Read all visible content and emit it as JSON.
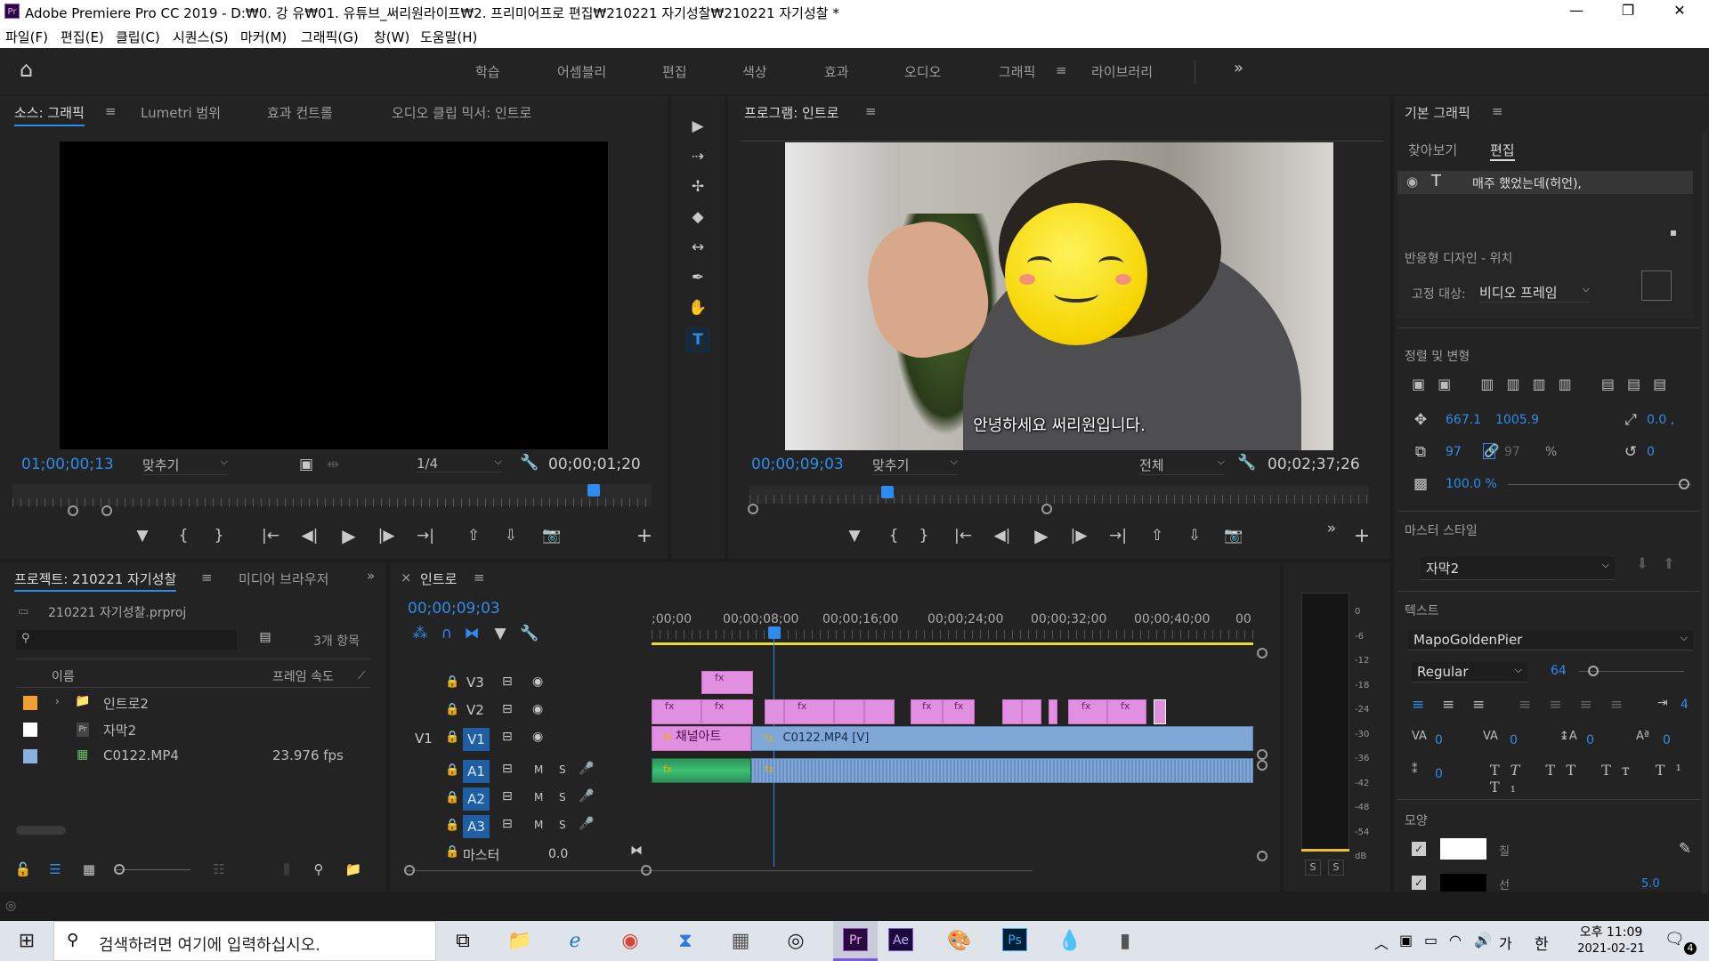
{
  "titlebar": {
    "title": "Adobe Premiere Pro CC 2019 - D:₩0. 강 유₩01. 유튜브_써리원라이프₩2. 프리미어프로 편집₩210221 자기성찰₩210221 자기성찰 *",
    "app_badge": "Pr",
    "min": "—",
    "max": "❐",
    "close": "✕"
  },
  "menu": [
    "파일(F)",
    "편집(E)",
    "클립(C)",
    "시퀀스(S)",
    "마커(M)",
    "그래픽(G)",
    "창(W)",
    "도움말(H)"
  ],
  "workspaces": {
    "items": [
      "학습",
      "어셈블리",
      "편집",
      "색상",
      "효과",
      "오디오",
      "그래픽",
      "라이브러리"
    ],
    "active": "그래픽",
    "menu_icon": "≡",
    "more": "»",
    "home": "⌂"
  },
  "source": {
    "tabs": [
      "소스: 그래픽",
      "Lumetri 범위",
      "효과 컨트롤",
      "오디오 클립 믹서: 인트로"
    ],
    "tab_menu": "≡",
    "timecode": "01;00;00;13",
    "fit": "맞추기",
    "resolution": "1/4",
    "duration": "00;00;01;20"
  },
  "program": {
    "title": "프로그램: 인트로",
    "menu": "≡",
    "caption": "안녕하세요 써리원입니다.",
    "timecode": "00;00;09;03",
    "fit": "맞추기",
    "quality": "전체",
    "duration": "00;02;37;26",
    "more": "»"
  },
  "tools": [
    "▶",
    "⇢",
    "✢",
    "◆",
    "↔",
    "✒",
    "✋",
    "T"
  ],
  "transport": {
    "marker": "▼",
    "in": "{",
    "out": "}",
    "go_in": "|←",
    "step_back": "◀|",
    "play": "▶",
    "step_fwd": "|▶",
    "go_out": "→|",
    "lift": "⇧",
    "extract": "⇩",
    "export": "📷",
    "add": "+"
  },
  "project": {
    "tab": "프로젝트: 210221 자기성찰",
    "menu": "≡",
    "tab2": "미디어 브라우저",
    "more": "»",
    "file": "210221 자기성찰.prproj",
    "count": "3개 항목",
    "col_name": "이름",
    "col_fps": "프레임 속도",
    "items": [
      {
        "name": "인트로2",
        "fps": "",
        "color": "#f0a030",
        "icon": "📁"
      },
      {
        "name": "자막2",
        "fps": "",
        "color": "#ffffff",
        "icon": "Pr"
      },
      {
        "name": "C0122.MP4",
        "fps": "23.976 fps",
        "color": "#8ab0e0",
        "icon": "▦"
      }
    ]
  },
  "timeline": {
    "close": "×",
    "title": "인트로",
    "menu": "≡",
    "timecode": "00;00;09;03",
    "ruler": [
      ";00;00",
      "00;00;08;00",
      "00;00;16;00",
      "00;00;24;00",
      "00;00;32;00",
      "00;00;40;00",
      "00"
    ],
    "tracks": [
      {
        "id": "V3",
        "src": ""
      },
      {
        "id": "V2",
        "src": ""
      },
      {
        "id": "V1",
        "src": "V1"
      },
      {
        "id": "A1",
        "src": ""
      },
      {
        "id": "A2",
        "src": ""
      },
      {
        "id": "A3",
        "src": ""
      }
    ],
    "mute": "M",
    "solo": "S",
    "master": "마스터",
    "master_val": "0.0",
    "fx": "fx",
    "clip_channel": "채널아트",
    "clip_main": "C0122.MP4 [V]"
  },
  "meter": {
    "labels": [
      "0",
      "-6",
      "-12",
      "-18",
      "-24",
      "-30",
      "-36",
      "-42",
      "-48",
      "-54",
      "dB"
    ],
    "s1": "S",
    "s2": "S"
  },
  "essential": {
    "title": "기본 그래픽",
    "menu": "≡",
    "tab_browse": "찾아보기",
    "tab_edit": "편집",
    "layer": "매주 했었는데(허언),",
    "responsive": "반응형 디자인 - 위치",
    "pin_label": "고정 대상:",
    "pin_value": "비디오 프레임",
    "align": "정렬 및 변형",
    "pos_x": "667.1",
    "pos_y": "1005.9",
    "anchor": "0.0 ,",
    "scale": "97",
    "scale2": "97",
    "pct": "%",
    "rotation": "0",
    "opacity": "100.0 %",
    "master_style": "마스터 스타일",
    "style_value": "자막2",
    "text": "텍스트",
    "font": "MapoGoldenPier",
    "font_style": "Regular",
    "font_size": "64",
    "kern": "0",
    "track": "0",
    "lead": "0",
    "baseline": "0",
    "tsume": "0",
    "tab_w": "4",
    "appearance": "모양",
    "fill": "칠",
    "stroke": "선",
    "stroke_w": "5.0"
  },
  "taskbar": {
    "search": "검색하려면 여기에 입력하십시오.",
    "time": "오후 11:09",
    "date": "2021-02-21",
    "ime": "한",
    "lang": "가",
    "notify": "4"
  }
}
